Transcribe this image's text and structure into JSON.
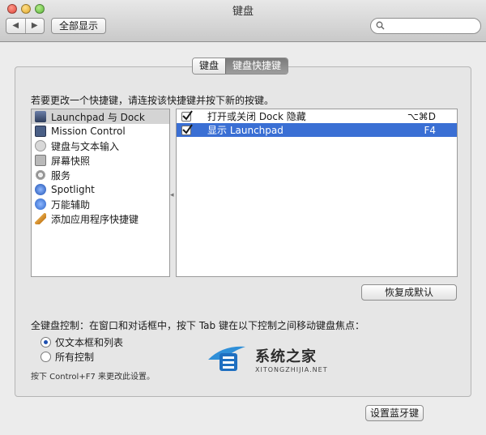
{
  "window": {
    "title": "键盘"
  },
  "toolbar": {
    "back_label": "◀",
    "forward_label": "▶",
    "show_all_label": "全部显示",
    "search_placeholder": ""
  },
  "tabs": [
    {
      "label": "键盘",
      "active": false
    },
    {
      "label": "键盘快捷键",
      "active": true
    }
  ],
  "instruction": "若要更改一个快捷键，请连按该快捷键并按下新的按键。",
  "categories": [
    {
      "label": "Launchpad 与 Dock",
      "icon": "launchpad-icon",
      "selected": true
    },
    {
      "label": "Mission Control",
      "icon": "mission-control-icon",
      "selected": false
    },
    {
      "label": "键盘与文本输入",
      "icon": "keyboard-icon",
      "selected": false
    },
    {
      "label": "屏幕快照",
      "icon": "screenshot-icon",
      "selected": false
    },
    {
      "label": "服务",
      "icon": "gear-icon",
      "selected": false
    },
    {
      "label": "Spotlight",
      "icon": "spotlight-icon",
      "selected": false
    },
    {
      "label": "万能辅助",
      "icon": "accessibility-icon",
      "selected": false
    },
    {
      "label": "添加应用程序快捷键",
      "icon": "app-shortcut-icon",
      "selected": false
    }
  ],
  "shortcuts": [
    {
      "label": "打开或关闭 Dock 隐藏",
      "key": "⌥⌘D",
      "checked": true,
      "selected": false
    },
    {
      "label": "显示 Launchpad",
      "key": "F4",
      "checked": true,
      "selected": true
    }
  ],
  "buttons": {
    "restore_defaults": "恢复成默认",
    "bluetooth": "设置蓝牙键"
  },
  "keyboard_access": {
    "label": "全键盘控制：在窗口和对话框中，按下 Tab 键在以下控制之间移动键盘焦点：",
    "options": [
      {
        "label": "仅文本框和列表",
        "selected": true
      },
      {
        "label": "所有控制",
        "selected": false
      }
    ],
    "hint": "按下 Control+F7 来更改此设置。"
  },
  "watermark": {
    "title": "系统之家",
    "subtitle": "XITONGZHIJIA.NET"
  },
  "colors": {
    "selection": "#3a6fd4",
    "accent": "#1d4fb0"
  }
}
